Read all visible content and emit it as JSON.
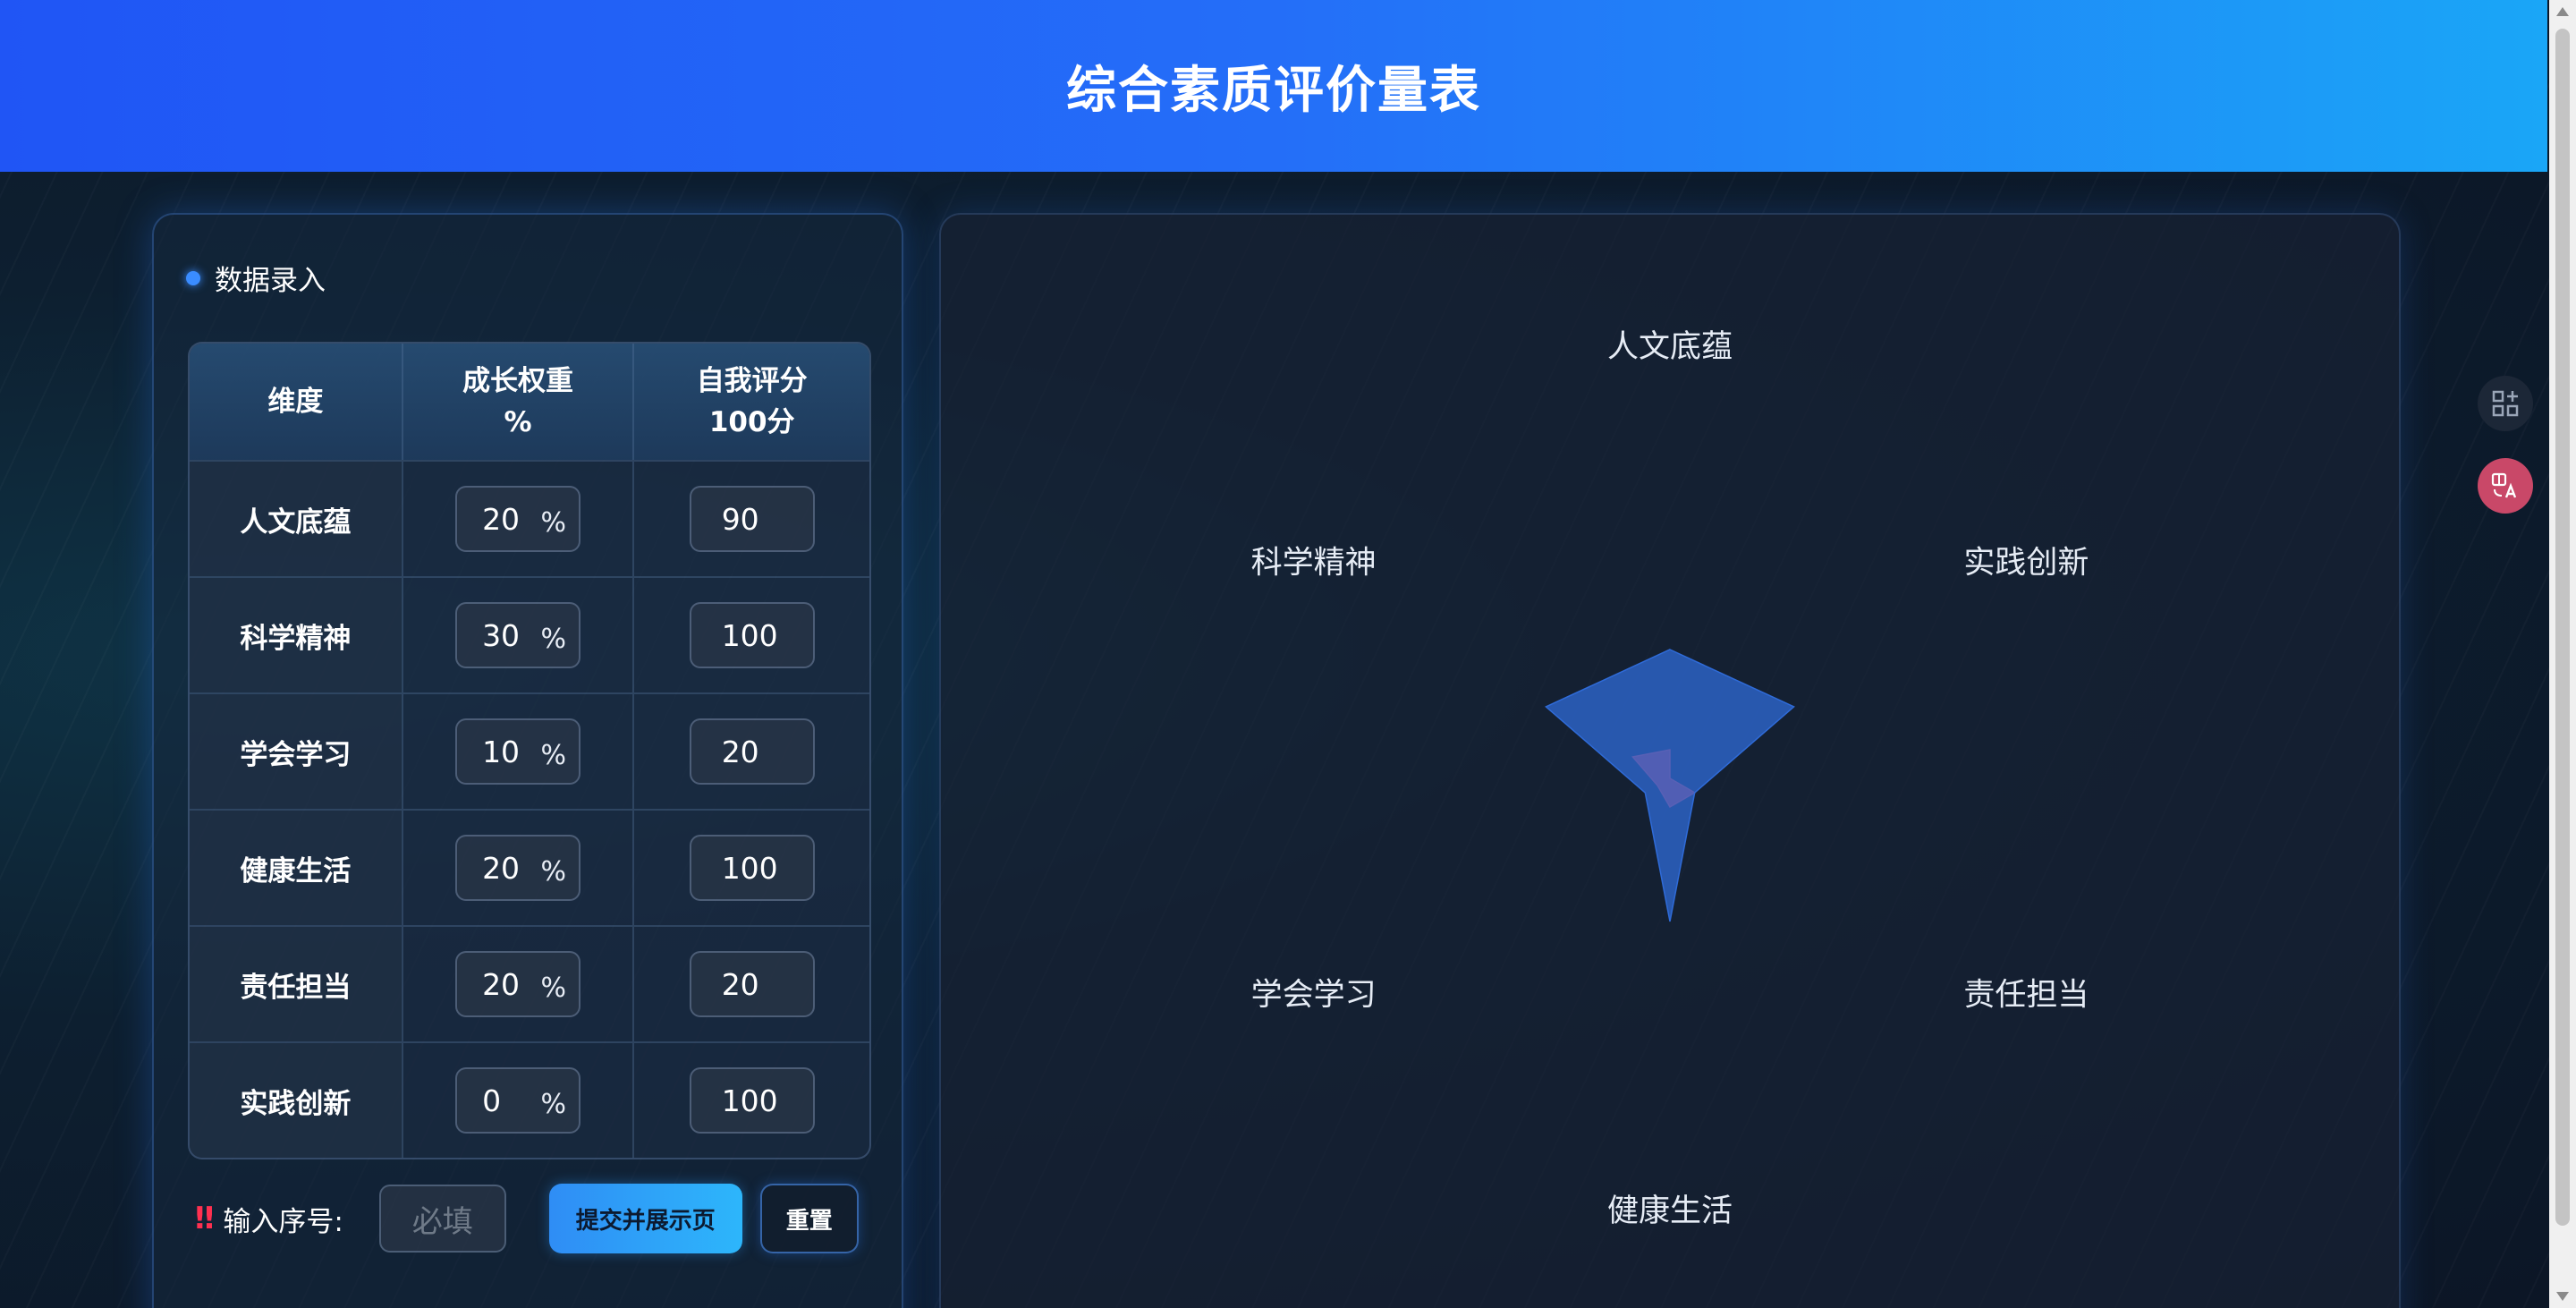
{
  "header": {
    "title": "综合素质评价量表"
  },
  "input_panel": {
    "title": "数据录入",
    "columns": {
      "dimension": "维度",
      "weight_line1": "成长权重",
      "weight_line2": "%",
      "score_line1": "自我评分",
      "score_line2": "100分"
    },
    "rows": [
      {
        "dimension": "人文底蕴",
        "weight": "20",
        "weight_unit": "%",
        "score": "90"
      },
      {
        "dimension": "科学精神",
        "weight": "30",
        "weight_unit": "%",
        "score": "100"
      },
      {
        "dimension": "学会学习",
        "weight": "10",
        "weight_unit": "%",
        "score": "20"
      },
      {
        "dimension": "健康生活",
        "weight": "20",
        "weight_unit": "%",
        "score": "100"
      },
      {
        "dimension": "责任担当",
        "weight": "20",
        "weight_unit": "%",
        "score": "20"
      },
      {
        "dimension": "实践创新",
        "weight": "0",
        "weight_unit": "%",
        "score": "100"
      }
    ],
    "serial": {
      "warning_glyph": "‼",
      "label": "输入序号:",
      "placeholder": "必填"
    },
    "submit_label": "提交并展示页",
    "reset_label": "重置"
  },
  "chart_data": {
    "type": "radar",
    "indicators": [
      "人文底蕴",
      "实践创新",
      "责任担当",
      "健康生活",
      "学会学习",
      "科学精神"
    ],
    "series": [
      {
        "values": [
          20,
          0,
          20,
          20,
          10,
          30
        ],
        "color": "#d2404e"
      },
      {
        "values": [
          90,
          100,
          20,
          100,
          20,
          100
        ],
        "color": "#2f6bd8"
      }
    ]
  },
  "tools": {
    "grid_icon": "apps-grid-icon",
    "translate_icon": "translate-icon"
  },
  "colors": {
    "header_start": "#2055f5",
    "header_end": "#1aa6f7",
    "accent": "#3a8cff",
    "warning": "#ff3050"
  }
}
